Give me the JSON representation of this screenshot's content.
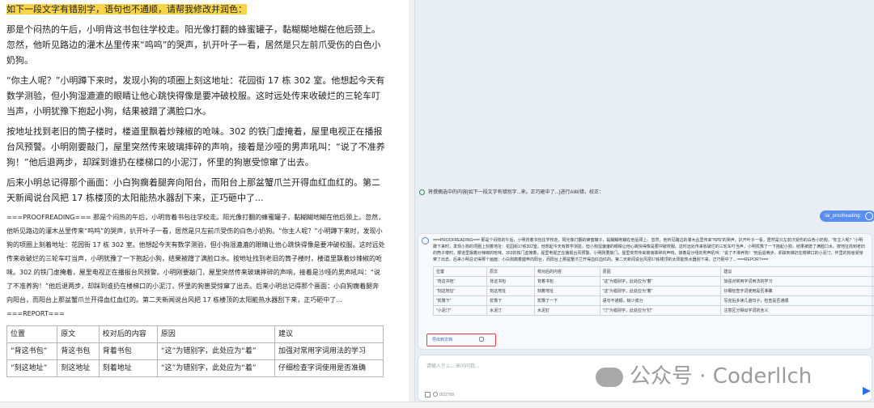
{
  "doc": {
    "highlight": "如下一段文字有错别字，语句也不通顺，请帮我修改并润色：",
    "paragraphs": [
      "那是个闷热的午后，小明背这书包往学校走。阳光像打翻的蜂蜜罐子，黏糊糊地糊在他后颈上。忽然，他听见路边的灌木丛里传来“呜呜”的哭声，扒开叶子一看，居然是只左前爪受伤的白色小奶狗。",
      "“你主人呢？”小明蹲下来时，发现小狗的项圈上刻这地址：花园街 17 栋 302 室。他想起今天有数学测验，但小狗湿漉漉的眼睛让他心跳快得像是要冲破校服。这时远处传来收破烂的三轮车叮当声，小明犹豫下抱起小狗，结果被蹭了满脸口水。",
      "按地址找到老旧的筒子楼时，楼道里飘着炒辣椒的呛味。302 的铁门虚掩着，屋里电视正在播报台风预警。小明刚要敲门，屋里突然传来玻璃摔碎的声响，接着是沙哑的男声吼叫：“说了不准养狗！”他后退两步，却踩到谁扔在楼梯口的小泥汀，怀里的狗崽受惊窜了出去。",
      "后来小明总记得那个画面：小白狗瘸着腿奔向阳台，而阳台上那盆蟹爪兰开得血红血红的。第二天新闻说台风把 17 栋楼顶的太阳能热水器刮下来，正巧砸中了..."
    ],
    "small_text": "===PROOFREADING=== 那是个闷热的午后，小明背着书包往学校走。阳光像打翻的蜂蜜罐子，黏糊糊地糊在他后颈上。忽然，他听见路边的灌木丛里传来“呜呜”的哭声，扒开叶子一看，居然是只左前爪受伤的白色小奶狗。“你主人呢？”小明蹲下来时，发现小狗的项圈上刻着地址：花园街 17 栋 302 室。他想起今天有数学测验，但小狗湿漉漉的眼睛让他心跳快得像是要冲破校服。这时远处传来收破烂的三轮车叮当声，小明犹豫了一下抱起小狗，结果被蹭了满脸口水。按地址找到老旧的筒子楼时，楼道里飘着炒辣椒的呛味。302 的铁门虚掩着，屋里电视正在播报台风预警。小明刚要敲门，屋里突然传来玻璃摔碎的声响，接着是沙哑的男声吼叫：“说了不准养狗！”他后退两步，却踩到谁扔在楼梯口的小泥汀，怀里的狗崽受惊窜了出去。后来小明总记得那个画面：小白狗瘸着腿奔向阳台，而阳台上那盆蟹爪兰开得血红血红的。第二天新闻说台风把 17 栋楼顶的太阳能热水器刮下来，正巧砸中了... ===REPORT===",
    "table": {
      "headers": [
        "位置",
        "原文",
        "校对后的内容",
        "原因",
        "建议"
      ],
      "rows": [
        [
          "“背这书包”",
          "背这书包",
          "背着书包",
          "“这”为错别字，此处应为“着”",
          "加强对常用字词用法的学习"
        ],
        [
          "“刻这地址”",
          "刻这地址",
          "刻着地址",
          "“这”为错别字，此处应为“着”",
          "仔细检查字词使用是否准确"
        ]
      ]
    }
  },
  "panel": {
    "info_text": "将撰摘选中的内容[如下一段文字有错别字...来。正巧砸中了...]进行AI纠错，校正：",
    "user_command": "/ai_proofreading:",
    "response_text": "===PROOFREADING=== 那是个闷热的午后，小明背着书包往学校走。阳光像打翻的蜂蜜罐子，黏糊糊地糊在他后颈上。忽然，他听见路边的灌木丛里传来“呜呜”的哭声，扒开叶子一看，居然是只左前爪受伤的白色小奶狗。“你主人呢？”小明蹲下来时，发现小狗的项圈上刻着地址：花园街17栋302室。他想起今天有数学测验，但小狗湿漉漉的眼睛让他心跳快得像是要冲破校服。这时远处传来收破烂的三轮车叮当声，小明犹豫了一下抱起小狗，结果被蹭了满脸口水。按地址找到老旧的筒子楼时，楼道里飘着炒辣椒的呛味。302的铁门虚掩着，屋里电视正在播报台风预警。小明刚要敲门，屋里突然传来玻璃摔碎的声响，接着是沙哑的男声吼叫：“说了不准养狗！”他后退两步，却踩到谁扔在楼梯口的小泥汀，怀里的狗崽受惊窜了出去。后来小明总记得那个画面：小白狗瘸着腿奔向阳台，而阳台上那盆蟹爪兰开得血红血红的。第二天新闻说台风把17栋楼顶的太阳能热水器刮下来，正巧砸中了... ===REPORT===",
    "table": {
      "headers": [
        "位置",
        "原文",
        "校对后的内容",
        "原因",
        "建议"
      ],
      "rows": [
        [
          "“背这书包”",
          "背这书包",
          "背着书包",
          "“这”为错别字，此处应为“着”",
          "加强对常用字词用法的学习"
        ],
        [
          "“刻这地址”",
          "刻这地址",
          "刻着地址",
          "“这”为错别字，此处应为“着”",
          "仔细检查字词使用是否准确"
        ],
        [
          "“犹豫下”",
          "犹豫下",
          "犹豫了一下",
          "语句不通顺，缺少成分",
          "写完后多读几遍句子，检查是否通顺"
        ],
        [
          "“小泥汀”",
          "水泥汀",
          "水泥钉",
          "“汀”为错别字，此处应为“钉”",
          "注意区分相似字词的含义"
        ]
      ]
    },
    "action_button": "导出到文档",
    "input_placeholder": "请输入什么，来问问我...",
    "char_count": "0/32768"
  },
  "watermark": "公众号 · Coderllch"
}
